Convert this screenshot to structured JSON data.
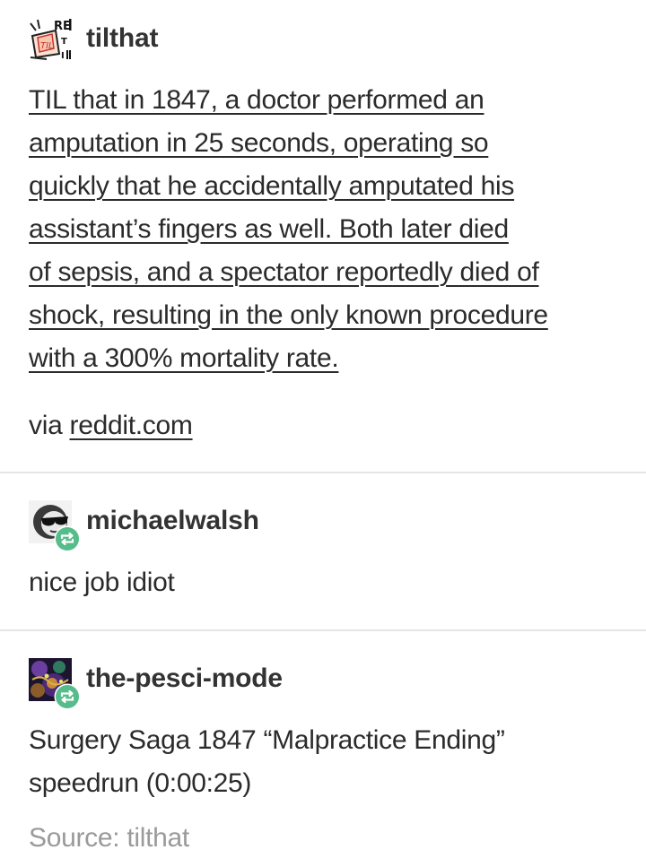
{
  "posts": [
    {
      "username": "tilthat",
      "avatar_icon": "til-logo-icon",
      "link_lines": [
        "TIL that in 1847, a doctor performed an",
        "amputation in 25 seconds, operating so",
        "quickly that he accidentally amputated his",
        "assistant’s fingers as well. Both later died",
        "of sepsis, and a spectator reportedly died of",
        "shock, resulting in the only known procedure",
        "with a 300% mortality rate."
      ],
      "via_prefix": "via ",
      "via_link": "reddit.com"
    },
    {
      "username": "michaelwalsh",
      "avatar_icon": "sunglasses-face-icon",
      "badge_icon": "reblog-icon",
      "text": "nice job idiot"
    },
    {
      "username": "the-pesci-mode",
      "avatar_icon": "psychedelic-art-icon",
      "badge_icon": "reblog-icon",
      "lines": [
        "Surgery Saga 1847 “Malpractice Ending”",
        "speedrun (0:00:25)"
      ]
    }
  ],
  "source": {
    "label": "Source: tilthat"
  },
  "colors": {
    "text": "#2b2b2b",
    "muted": "#9a9a9a",
    "divider": "#e6e6e6",
    "reblog_green": "#56bc8a"
  }
}
